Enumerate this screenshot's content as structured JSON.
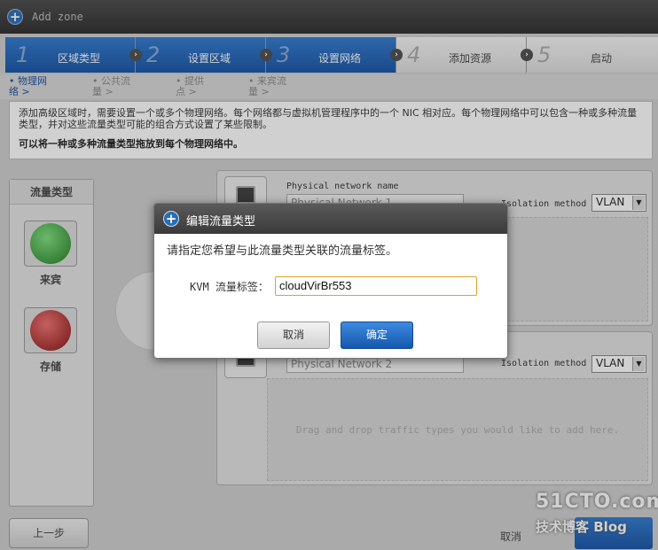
{
  "window": {
    "title": "Add zone"
  },
  "steps": [
    {
      "num": "1",
      "label": "区域类型",
      "state": "active"
    },
    {
      "num": "2",
      "label": "设置区域",
      "state": "active"
    },
    {
      "num": "3",
      "label": "设置网络",
      "state": "active"
    },
    {
      "num": "4",
      "label": "添加资源",
      "state": "inactive"
    },
    {
      "num": "5",
      "label": "启动",
      "state": "inactive"
    }
  ],
  "subtabs": [
    {
      "line1": "• 物理网",
      "line2": "络 >",
      "state": "active"
    },
    {
      "line1": "• 公共流",
      "line2": "量 >",
      "state": "inactive"
    },
    {
      "line1": "• 提供",
      "line2": "点 >",
      "state": "inactive"
    },
    {
      "line1": "• 来宾流",
      "line2": "量 >",
      "state": "inactive"
    }
  ],
  "description": {
    "text": "添加高级区域时，需要设置一个或多个物理网络。每个网络都与虚拟机管理程序中的一个 NIC 相对应。每个物理网络中可以包含一种或多种流量类型，并对这些流量类型可能的组合方式设置了某些限制。",
    "bold": "可以将一种或多种流量类型拖放到每个物理网络中。"
  },
  "traffic_panel": {
    "title": "流量类型",
    "items": [
      {
        "label": "来宾",
        "icon": "guest-traffic-icon",
        "color": "#2f9b2f"
      },
      {
        "label": "存储",
        "icon": "storage-traffic-icon",
        "color": "#c02020"
      }
    ]
  },
  "networks": [
    {
      "name_label": "Physical network name",
      "name_value": "Physical Network 1",
      "isolation_label": "Isolation method",
      "isolation_value": "VLAN"
    },
    {
      "name_value": "Physical Network 2",
      "isolation_label": "Isolation method",
      "isolation_value": "VLAN",
      "drop_hint": "Drag and drop traffic types you would like to add here."
    }
  ],
  "buttons": {
    "prev": "上一步",
    "cancel": "取消"
  },
  "watermark": {
    "line1": "51CTO.com",
    "line2": "技术博客",
    "line3": "Blog"
  },
  "modal": {
    "title": "编辑流量类型",
    "message": "请指定您希望与此流量类型关联的流量标签。",
    "kvm_label": "KVM 流量标签：",
    "kvm_value": "cloudVirBr553",
    "cancel": "取消",
    "ok": "确定"
  },
  "colors": {
    "accent": "#1b5fb8",
    "input_focus": "#e0a030"
  }
}
